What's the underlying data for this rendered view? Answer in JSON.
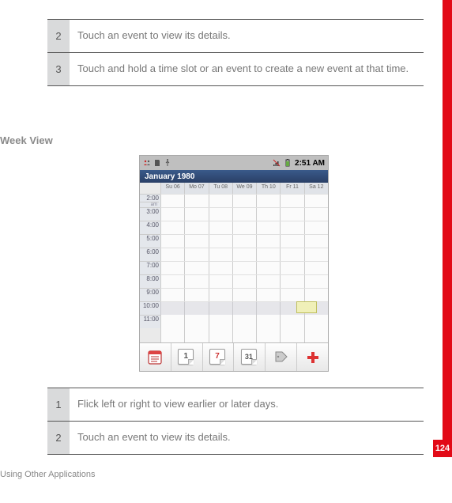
{
  "page_number": "124",
  "footer": "Using Other Applications",
  "section_heading": "Week View",
  "table_top": {
    "rows": [
      {
        "num": "2",
        "text": "Touch an event to view its details."
      },
      {
        "num": "3",
        "text": "Touch and hold a time slot or an event to create a new event at that time."
      }
    ]
  },
  "table_bottom": {
    "rows": [
      {
        "num": "1",
        "text": "Flick left or right to view earlier or later days."
      },
      {
        "num": "2",
        "text": "Touch an event to view its details."
      }
    ]
  },
  "phone": {
    "status_time": "2:51 AM",
    "month_label": "January 1980",
    "day_headers": [
      "Su 06",
      "Mo 07",
      "Tu 08",
      "We 09",
      "Th 10",
      "Fr 11",
      "Sa 12"
    ],
    "time_slots": [
      "2:00",
      "3:00",
      "4:00",
      "5:00",
      "6:00",
      "7:00",
      "8:00",
      "9:00",
      "10:00",
      "11:00"
    ],
    "am_label": "am",
    "toolbar": {
      "day_num": "1",
      "week_num": "7",
      "month_num": "31"
    }
  }
}
